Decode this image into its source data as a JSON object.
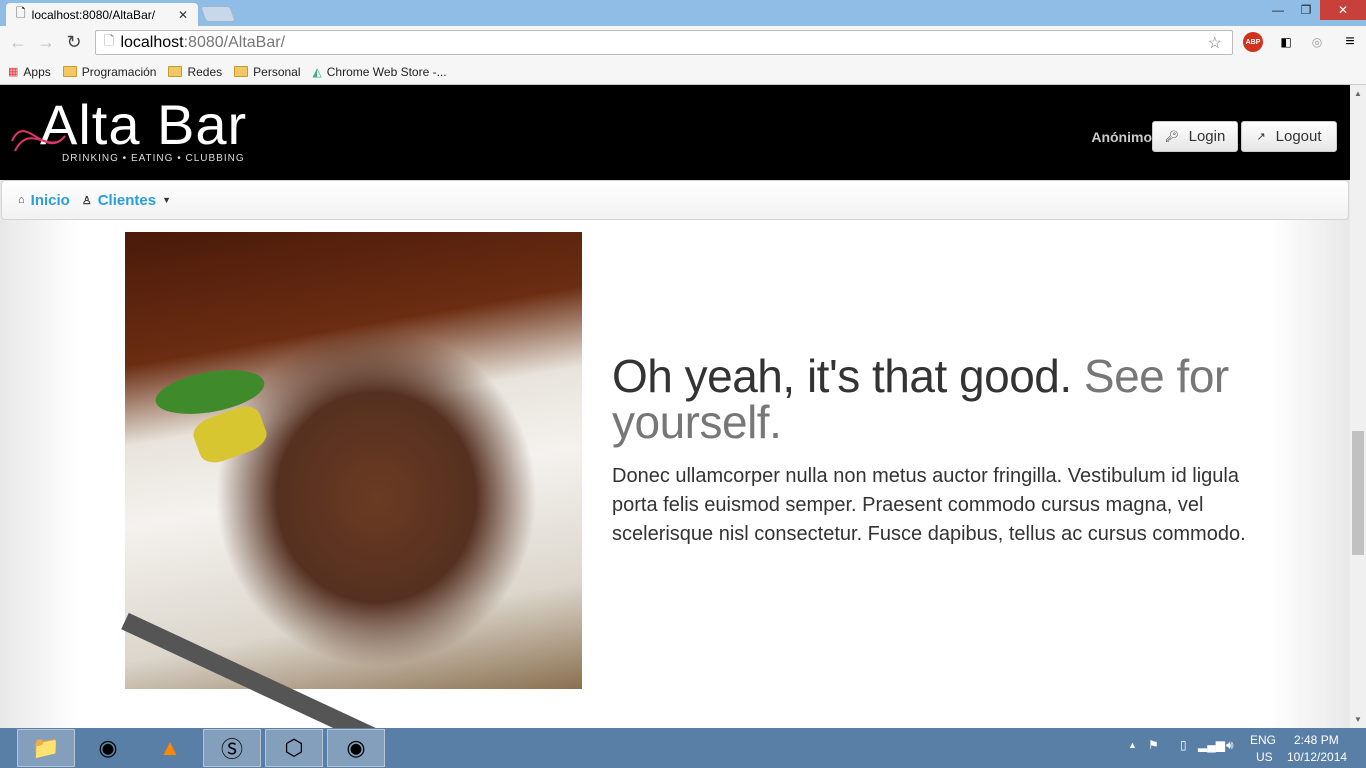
{
  "browser": {
    "tab_title": "localhost:8080/AltaBar/",
    "url_host": "localhost",
    "url_rest": ":8080/AltaBar/",
    "bookmarks": [
      {
        "label": "Apps",
        "icon": "apps-grid-icon"
      },
      {
        "label": "Programación",
        "icon": "folder-icon"
      },
      {
        "label": "Redes",
        "icon": "folder-icon"
      },
      {
        "label": "Personal",
        "icon": "folder-icon"
      },
      {
        "label": "Chrome Web Store -...",
        "icon": "chrome-store-icon"
      }
    ],
    "extensions": [
      "ABP"
    ]
  },
  "header": {
    "logo_text": "Alta Bar",
    "logo_tagline": "DRINKING • EATING • CLUBBING",
    "user": "Anónimo",
    "login_label": "Login",
    "logout_label": "Logout"
  },
  "nav": {
    "items": [
      {
        "label": "Inicio",
        "icon": "home-icon"
      },
      {
        "label": "Clientes",
        "icon": "user-icon",
        "dropdown": true
      }
    ]
  },
  "feature": {
    "heading": "Oh yeah, it's that good.",
    "heading_muted": "See for yourself.",
    "body": "Donec ullamcorper nulla non metus auctor fringilla. Vestibulum id ligula porta felis euismod semper. Praesent commodo cursus magna, vel scelerisque nisl consectetur. Fusce dapibus, tellus ac cursus commodo."
  },
  "taskbar": {
    "lang": "ENG",
    "region": "US",
    "time": "2:48 PM",
    "date": "10/12/2014"
  },
  "colors": {
    "accent": "#2a9fd6",
    "header_bg": "#000000",
    "taskbar": "#5a7fa6"
  }
}
